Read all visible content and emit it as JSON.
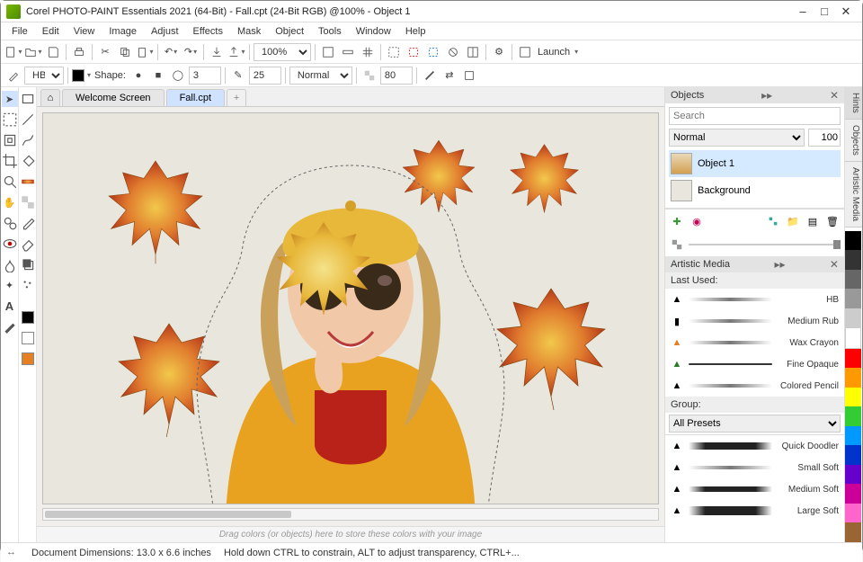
{
  "title": "Corel PHOTO-PAINT Essentials 2021 (64-Bit) - Fall.cpt (24-Bit RGB) @100% - Object 1",
  "menus": [
    "File",
    "Edit",
    "View",
    "Image",
    "Adjust",
    "Effects",
    "Mask",
    "Object",
    "Tools",
    "Window",
    "Help"
  ],
  "toolbar1": {
    "zoom": "100%",
    "launch": "Launch"
  },
  "toolbar2": {
    "brush": "HB",
    "shape_label": "Shape:",
    "stroke": "3",
    "size": "25",
    "blend": "Normal",
    "opacity": "80"
  },
  "tabs": {
    "welcome": "Welcome Screen",
    "doc": "Fall.cpt"
  },
  "color_tray_hint": "Drag colors (or objects) here to store these colors with your image",
  "objects_panel": {
    "title": "Objects",
    "search_placeholder": "Search",
    "blend": "Normal",
    "opacity": "100",
    "layers": [
      {
        "name": "Object 1",
        "selected": true
      },
      {
        "name": "Background",
        "selected": false
      }
    ]
  },
  "artistic_media": {
    "title": "Artistic Media",
    "last_used": "Last Used:",
    "brushes_recent": [
      "HB",
      "Medium Rub",
      "Wax Crayon",
      "Fine Opaque",
      "Colored Pencil"
    ],
    "group_label": "Group:",
    "group_value": "All Presets",
    "brushes_all": [
      "Quick Doodler",
      "Small Soft",
      "Medium Soft",
      "Large Soft"
    ]
  },
  "vert_tabs": [
    "Hints",
    "Objects",
    "Artistic Media"
  ],
  "palette": [
    "#000000",
    "#333333",
    "#666666",
    "#999999",
    "#cccccc",
    "#ffffff",
    "#ff0000",
    "#ff9900",
    "#ffff00",
    "#33cc33",
    "#0099ff",
    "#0033cc",
    "#6600cc",
    "#cc0099",
    "#ff66cc",
    "#996633"
  ],
  "status": {
    "dims": "Document Dimensions: 13.0 x 6.6 inches",
    "hint": "Hold down CTRL to constrain, ALT to adjust transparency, CTRL+..."
  }
}
